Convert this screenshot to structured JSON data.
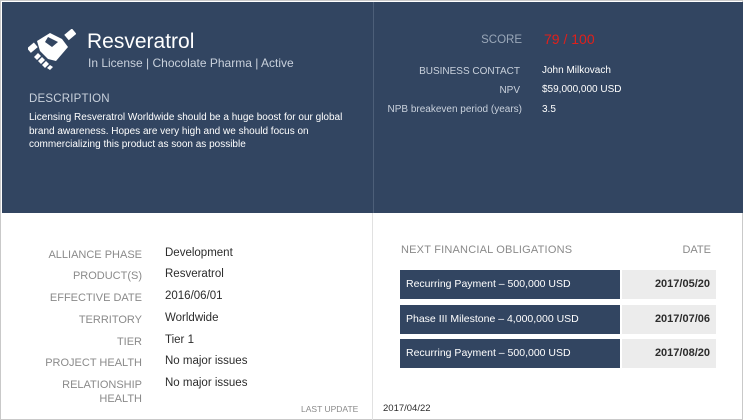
{
  "product": {
    "name": "Resveratrol",
    "subtitle": "In License | Chocolate Pharma | Active"
  },
  "description": {
    "label": "DESCRIPTION",
    "text": "Licensing Resveratrol Worldwide should be a huge boost for our global brand awareness. Hopes are very high and we should focus on commercializing this product as soon as possible"
  },
  "score": {
    "label": "SCORE",
    "value": "79 / 100"
  },
  "summary": [
    {
      "label": "BUSINESS CONTACT",
      "value": "John Milkovach"
    },
    {
      "label": "NPV",
      "value": "$59,000,000 USD"
    },
    {
      "label": "NPB breakeven period (years)",
      "value": "3.5"
    }
  ],
  "details": [
    {
      "label": "ALLIANCE PHASE",
      "value": "Development"
    },
    {
      "label": "PRODUCT(S)",
      "value": "Resveratrol"
    },
    {
      "label": "EFFECTIVE DATE",
      "value": "2016/06/01"
    },
    {
      "label": "TERRITORY",
      "value": "Worldwide"
    },
    {
      "label": "TIER",
      "value": "Tier 1"
    },
    {
      "label": "PROJECT HEALTH",
      "value": "No major issues"
    },
    {
      "label": "RELATIONSHIP HEALTH",
      "value": "No major issues"
    }
  ],
  "last_update": {
    "label": "LAST UPDATE",
    "value": "2017/04/22"
  },
  "obligations": {
    "header": "NEXT FINANCIAL OBLIGATIONS",
    "date_header": "DATE",
    "rows": [
      {
        "description": "Recurring Payment – 500,000 USD",
        "date": "2017/05/20"
      },
      {
        "description": "Phase III Milestone – 4,000,000 USD",
        "date": "2017/07/06"
      },
      {
        "description": "Recurring Payment – 500,000 USD",
        "date": "2017/08/20"
      }
    ]
  },
  "colors": {
    "header_bg": "#324561",
    "score": "#e0201b",
    "row_bg": "#324561",
    "date_bg": "#ececec"
  },
  "icons": {
    "logo": "handshake-icon"
  }
}
